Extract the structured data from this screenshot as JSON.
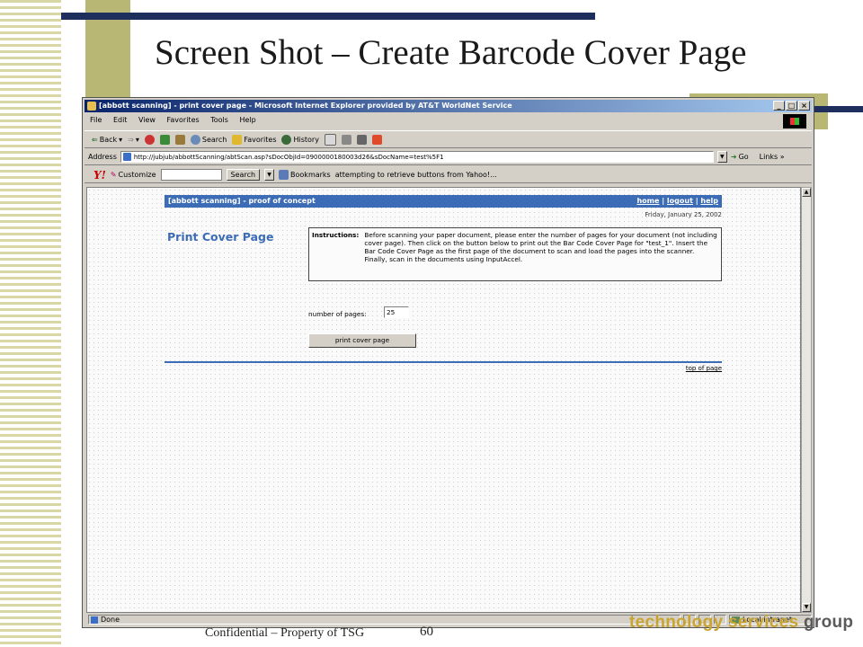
{
  "slide": {
    "title": "Screen Shot – Create Barcode Cover Page",
    "footer_confidential": "Confidential – Property of TSG",
    "page_number": "60",
    "logo_text": "technology services ",
    "logo_text2": "group"
  },
  "browser": {
    "window_title": "[abbott scanning] - print cover page - Microsoft Internet Explorer provided by AT&T WorldNet Service",
    "window_buttons": [
      "_",
      "□",
      "×"
    ],
    "menu": [
      "File",
      "Edit",
      "View",
      "Favorites",
      "Tools",
      "Help"
    ],
    "toolbar": {
      "back": "Back",
      "forward": "⇒",
      "search": "Search",
      "favorites": "Favorites",
      "history": "History"
    },
    "address": {
      "label": "Address",
      "url": "http://jubjub/abbottScanning/abtScan.asp?sDocObjId=0900000180003d26&sDocName=test%5F1",
      "go": "Go",
      "links": "Links »"
    },
    "yahoo": {
      "logo": "Y!",
      "customize": "Customize",
      "search_button": "Search",
      "bookmarks": "Bookmarks",
      "status": "attempting to retrieve buttons from Yahoo!..."
    },
    "status": {
      "done": "Done",
      "zone": "Local intranet"
    }
  },
  "page": {
    "header_title": "[abbott scanning] - proof of concept",
    "header_links": {
      "home": "home",
      "sep1": " | ",
      "logout": "logout",
      "sep2": " | ",
      "help": "help"
    },
    "date": "Friday, January 25, 2002",
    "heading": "Print Cover Page",
    "instructions_label": "Instructions:",
    "instructions_text": "Before scanning your paper document, please enter the number of pages for your document (not including cover page). Then click on the button below to print out the Bar Code Cover Page for \"test_1\". Insert the Bar Code Cover Page as the first page of the document to scan and load the pages into the scanner. Finally, scan in the documents using InputAccel.",
    "num_pages_label": "number of pages:",
    "num_pages_value": "25",
    "print_button": "print cover page",
    "top_of_page": "top of page"
  },
  "colors": {
    "navy": "#1e2f5e",
    "olive": "#b8b874",
    "page_blue": "#3b6cb5"
  }
}
